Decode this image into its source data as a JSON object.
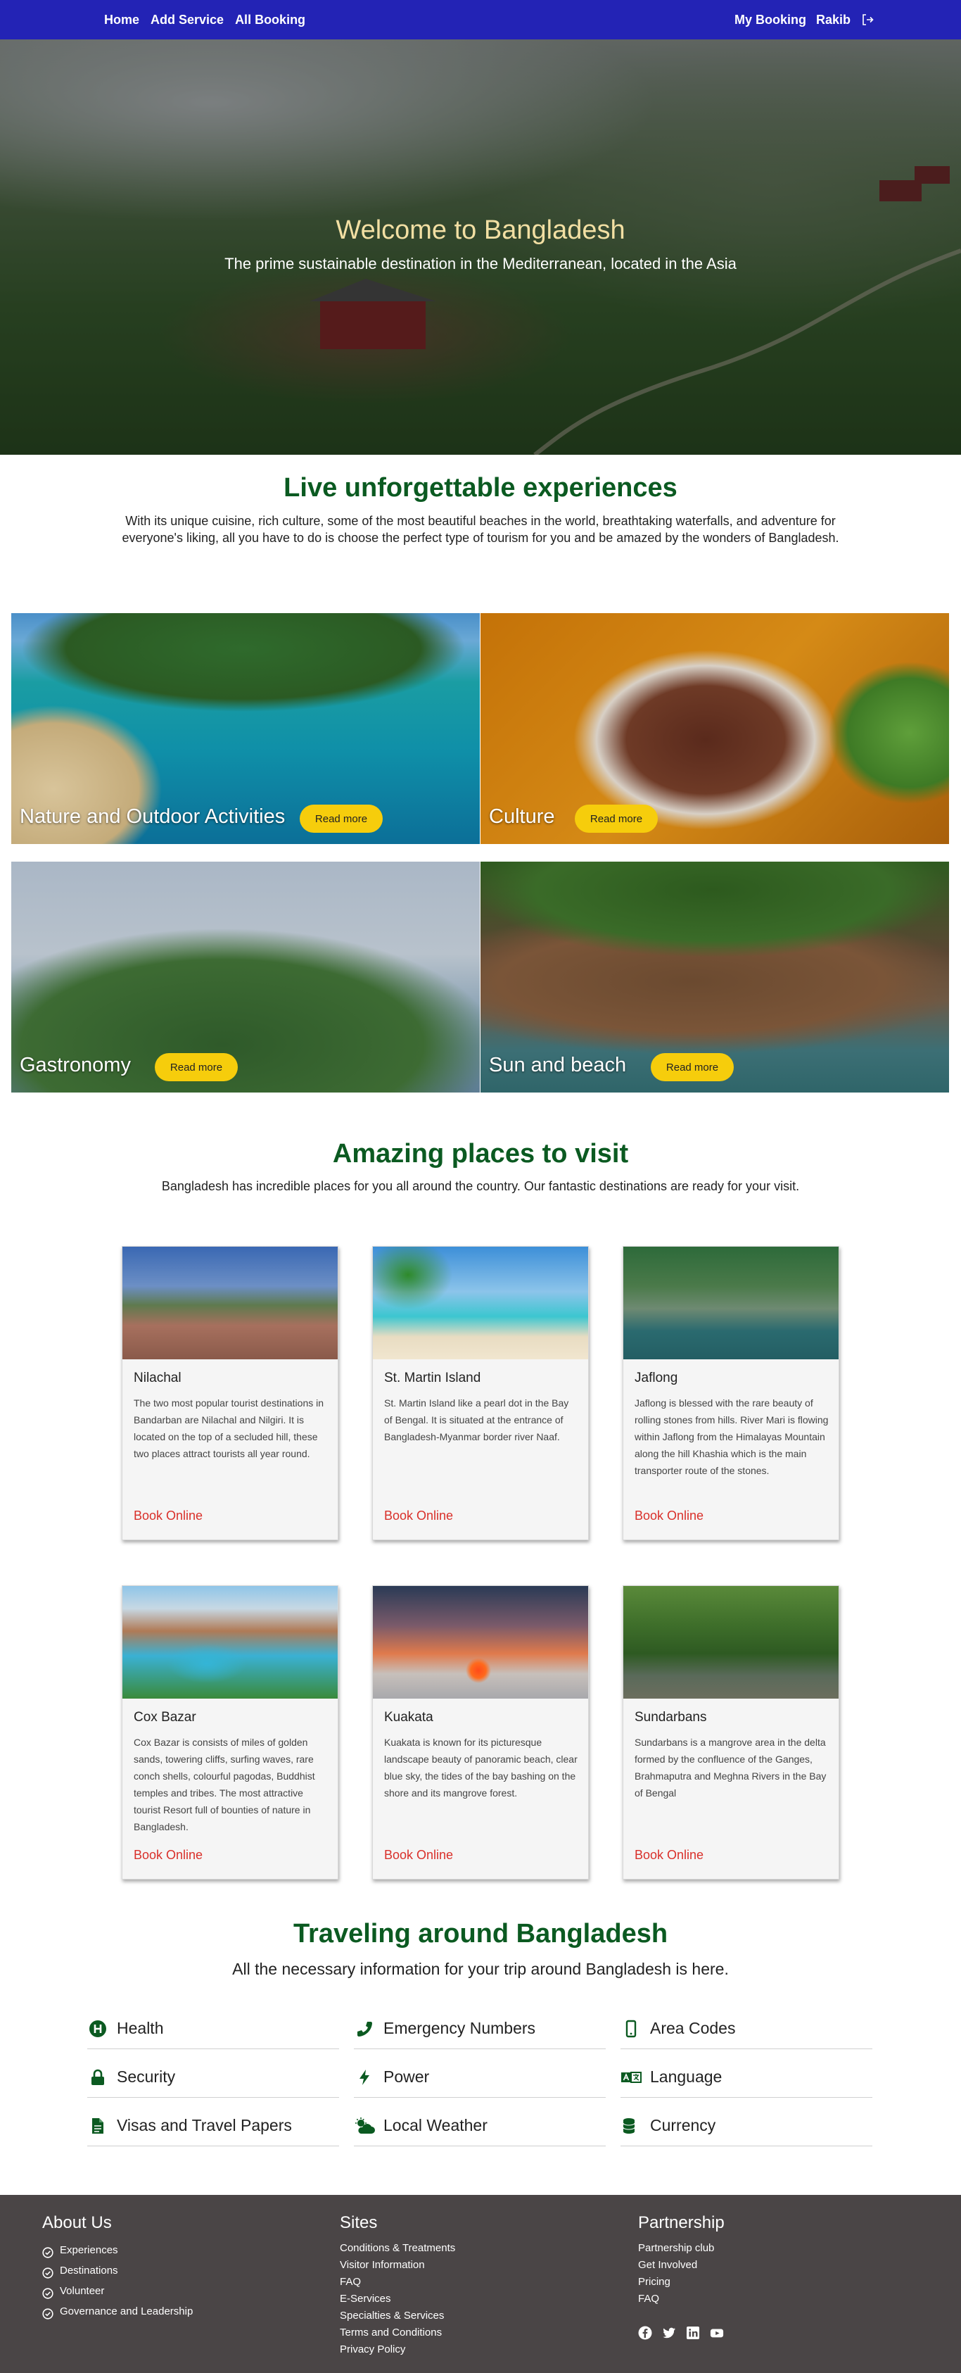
{
  "nav": {
    "home": "Home",
    "add_service": "Add Service",
    "all_booking": "All Booking",
    "my_booking": "My Booking",
    "user_name": "Rakib",
    "logout_icon": "logout-icon"
  },
  "hero": {
    "title": "Welcome to Bangladesh",
    "subtitle": "The prime sustainable destination in the Mediterranean, located in the Asia"
  },
  "experiences": {
    "title": "Live unforgettable experiences",
    "description": "With its unique cuisine, rich culture, some of the most beautiful beaches in the world, breathtaking waterfalls, and adventure for everyone's liking, all you have to do is choose the perfect type of tourism for you and be amazed by the wonders of Bangladesh.",
    "tiles": [
      {
        "label": "Nature and Outdoor Activities",
        "button": "Read more"
      },
      {
        "label": "Culture",
        "button": "Read more"
      },
      {
        "label": "Gastronomy",
        "button": "Read more"
      },
      {
        "label": "Sun and beach",
        "button": "Read more"
      }
    ]
  },
  "places": {
    "title": "Amazing places to visit",
    "description": "Bangladesh has incredible places for you all around the country. Our fantastic destinations are ready for your visit.",
    "cards": [
      {
        "name": "Nilachal",
        "text": "The two most popular tourist destinations in Bandarban are Nilachal and Nilgiri. It is located on the top of a secluded hill, these two places attract tourists all year round.",
        "link": "Book Online"
      },
      {
        "name": "St. Martin Island",
        "text": "St. Martin Island like a pearl dot in the Bay of Bengal. It is situated at the entrance of Bangladesh-Myanmar border river Naaf.",
        "link": "Book Online"
      },
      {
        "name": "Jaflong",
        "text": "Jaflong is blessed with the rare beauty of rolling stones from hills. River Mari is flowing within Jaflong from the Himalayas Mountain along the hill Khashia which is the main transporter route of the stones.",
        "link": "Book Online"
      },
      {
        "name": "Cox Bazar",
        "text": "Cox Bazar is consists of miles of golden sands, towering cliffs, surfing waves, rare conch shells, colourful pagodas, Buddhist temples and tribes. The most attractive tourist Resort full of bounties of nature in Bangladesh.",
        "link": "Book Online"
      },
      {
        "name": "Kuakata",
        "text": "Kuakata is known for its picturesque landscape beauty of panoramic beach, clear blue sky, the tides of the bay bashing on the shore and its mangrove forest.",
        "link": "Book Online"
      },
      {
        "name": "Sundarbans",
        "text": "Sundarbans is a mangrove area in the delta formed by the confluence of the Ganges, Brahmaputra and Meghna Rivers in the Bay of Bengal",
        "link": "Book Online"
      }
    ]
  },
  "travel": {
    "title": "Traveling around Bangladesh",
    "subtitle": "All the necessary information for your trip around Bangladesh is here.",
    "items": [
      {
        "label": "Health",
        "icon": "hospital-icon"
      },
      {
        "label": "Emergency Numbers",
        "icon": "phone-icon"
      },
      {
        "label": "Area Codes",
        "icon": "mobile-icon"
      },
      {
        "label": "Security",
        "icon": "lock-icon"
      },
      {
        "label": "Power",
        "icon": "bolt-icon"
      },
      {
        "label": "Language",
        "icon": "language-icon"
      },
      {
        "label": "Visas and Travel Papers",
        "icon": "document-icon"
      },
      {
        "label": "Local Weather",
        "icon": "cloud-sun-icon"
      },
      {
        "label": "Currency",
        "icon": "coins-icon"
      }
    ]
  },
  "footer": {
    "about": {
      "title": "About Us",
      "items": [
        "Experiences",
        "Destinations",
        "Volunteer",
        "Governance and Leadership"
      ]
    },
    "sites": {
      "title": "Sites",
      "items": [
        "Conditions & Treatments",
        "Visitor Information",
        "FAQ",
        "E-Services",
        "Specialties & Services",
        "Terms and Conditions",
        "Privacy Policy"
      ]
    },
    "partnership": {
      "title": "Partnership",
      "items": [
        "Partnership club",
        "Get Involved",
        "Pricing",
        "FAQ"
      ],
      "social": [
        "facebook-icon",
        "twitter-icon",
        "linkedin-icon",
        "youtube-icon"
      ]
    }
  },
  "colors": {
    "navbar": "#2323b5",
    "heading_green": "#0b5a21",
    "hero_title": "#f2dfa3",
    "read_more_button": "#f6cd0c",
    "book_link": "#d9302a",
    "footer_bg": "#4a4546"
  }
}
